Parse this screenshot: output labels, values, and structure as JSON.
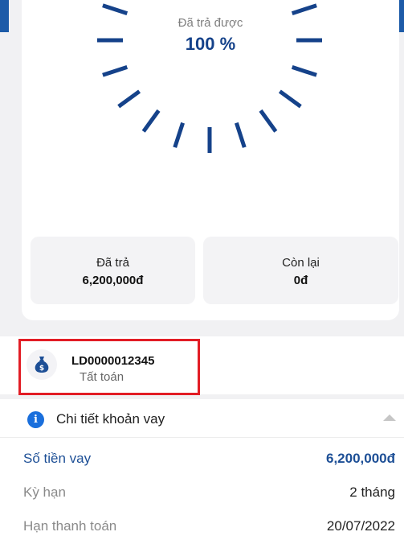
{
  "gauge": {
    "caption": "Đã trả được",
    "percent_label": "100 %",
    "paid_fraction": 1.0
  },
  "stats": {
    "paid_label": "Đã trả",
    "paid_value": "6,200,000đ",
    "remaining_label": "Còn lại",
    "remaining_value": "0đ"
  },
  "loan": {
    "icon": "money-bag-icon",
    "id": "LD0000012345",
    "status": "Tất toán"
  },
  "details": {
    "title": "Chi tiết khoản vay",
    "rows": [
      {
        "label": "Số tiền vay",
        "value": "6,200,000đ"
      },
      {
        "label": "Kỳ hạn",
        "value": "2 tháng"
      },
      {
        "label": "Hạn thanh toán",
        "value": "20/07/2022"
      }
    ]
  },
  "colors": {
    "accent": "#1d5ba8",
    "gauge_tick": "#15428a",
    "highlight": "#e21d25",
    "info": "#1a6fdc"
  }
}
